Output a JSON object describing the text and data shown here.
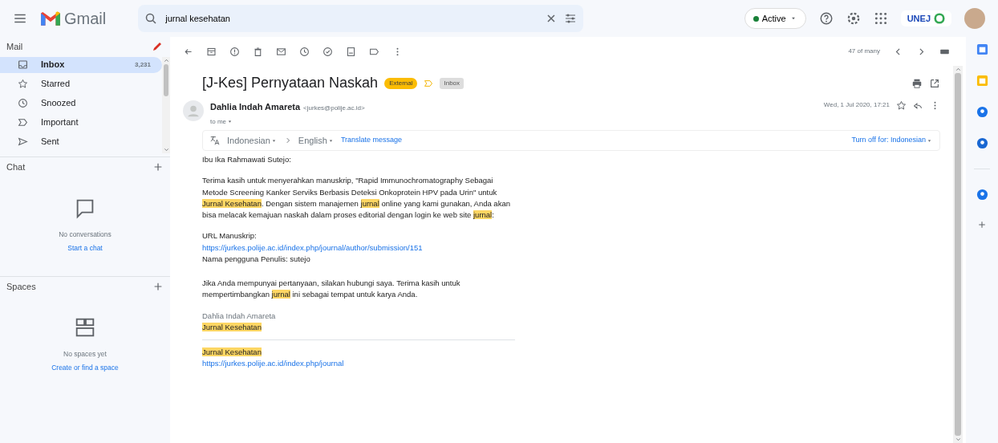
{
  "header": {
    "app_name": "Gmail",
    "search_value": "jurnal kesehatan",
    "status": "Active",
    "org_logo": "UNEJ"
  },
  "sidebar": {
    "mail_title": "Mail",
    "items": [
      {
        "label": "Inbox",
        "count": "3,231",
        "selected": true
      },
      {
        "label": "Starred",
        "selected": false
      },
      {
        "label": "Snoozed",
        "selected": false
      },
      {
        "label": "Important",
        "selected": false
      },
      {
        "label": "Sent",
        "selected": false
      }
    ],
    "chat": {
      "title": "Chat",
      "empty_text": "No conversations",
      "link": "Start a chat"
    },
    "spaces": {
      "title": "Spaces",
      "empty_text": "No spaces yet",
      "link": "Create or find a space"
    }
  },
  "toolbar": {
    "pager": "47 of many"
  },
  "message": {
    "subject": "[J-Kes] Pernyataan Naskah",
    "labels": [
      {
        "text": "External",
        "kind": "external"
      },
      {
        "text": "Inbox",
        "kind": "inbox"
      }
    ],
    "sender_name": "Dahlia Indah Amareta",
    "sender_email": "<jurkes@polije.ac.id>",
    "recipient": "to me",
    "date": "Wed, 1 Jul 2020, 17:21",
    "translate": {
      "from": "Indonesian",
      "to": "English",
      "action": "Translate message",
      "turn_off": "Turn off for: Indonesian"
    },
    "body": [
      {
        "kind": "text",
        "parts": [
          {
            "text": "Ibu Ika Rahmawati Sutejo:",
            "highlight": false
          }
        ]
      },
      {
        "kind": "text",
        "parts": [
          {
            "text": "Terima kasih untuk menyerahkan manuskrip, \"Rapid Immunochromatography Sebagai Metode Screening Kanker Serviks Berbasis Deteksi Onkoprotein HPV pada Urin\" untuk ",
            "highlight": false
          },
          {
            "text": "Jurnal Kesehatan",
            "highlight": true
          },
          {
            "text": ". Dengan sistem manajemen ",
            "highlight": false
          },
          {
            "text": "jurnal",
            "highlight": true
          },
          {
            "text": " online yang kami gunakan, Anda akan bisa melacak kemajuan naskah dalam proses editorial dengan login ke web site ",
            "highlight": false
          },
          {
            "text": "jurnal",
            "highlight": true
          },
          {
            "text": ":",
            "highlight": false
          }
        ]
      },
      {
        "kind": "lines",
        "lines": [
          {
            "text": "URL Manuskrip:",
            "link": false
          },
          {
            "text": "https://jurkes.polije.ac.id/index.php/journal/author/submission/151",
            "link": true
          },
          {
            "text": "Nama pengguna Penulis: sutejo",
            "link": false
          }
        ]
      },
      {
        "kind": "text",
        "parts": [
          {
            "text": "Jika Anda mempunyai pertanyaan, silakan hubungi saya. Terima kasih untuk mempertimbangkan ",
            "highlight": false
          },
          {
            "text": "jurnal",
            "highlight": true
          },
          {
            "text": " ini sebagai tempat untuk karya Anda.",
            "highlight": false
          }
        ]
      },
      {
        "kind": "signature",
        "lines": [
          {
            "text": "Dahlia Indah Amareta",
            "highlight": false
          },
          {
            "text": "Jurnal Kesehatan",
            "highlight": true
          }
        ]
      },
      {
        "kind": "footer",
        "lines": [
          {
            "text": "Jurnal Kesehatan",
            "highlight": true,
            "link": false
          },
          {
            "text": "https://jurkes.polije.ac.id/index.php/journal",
            "highlight": false,
            "link": true
          }
        ]
      }
    ]
  }
}
